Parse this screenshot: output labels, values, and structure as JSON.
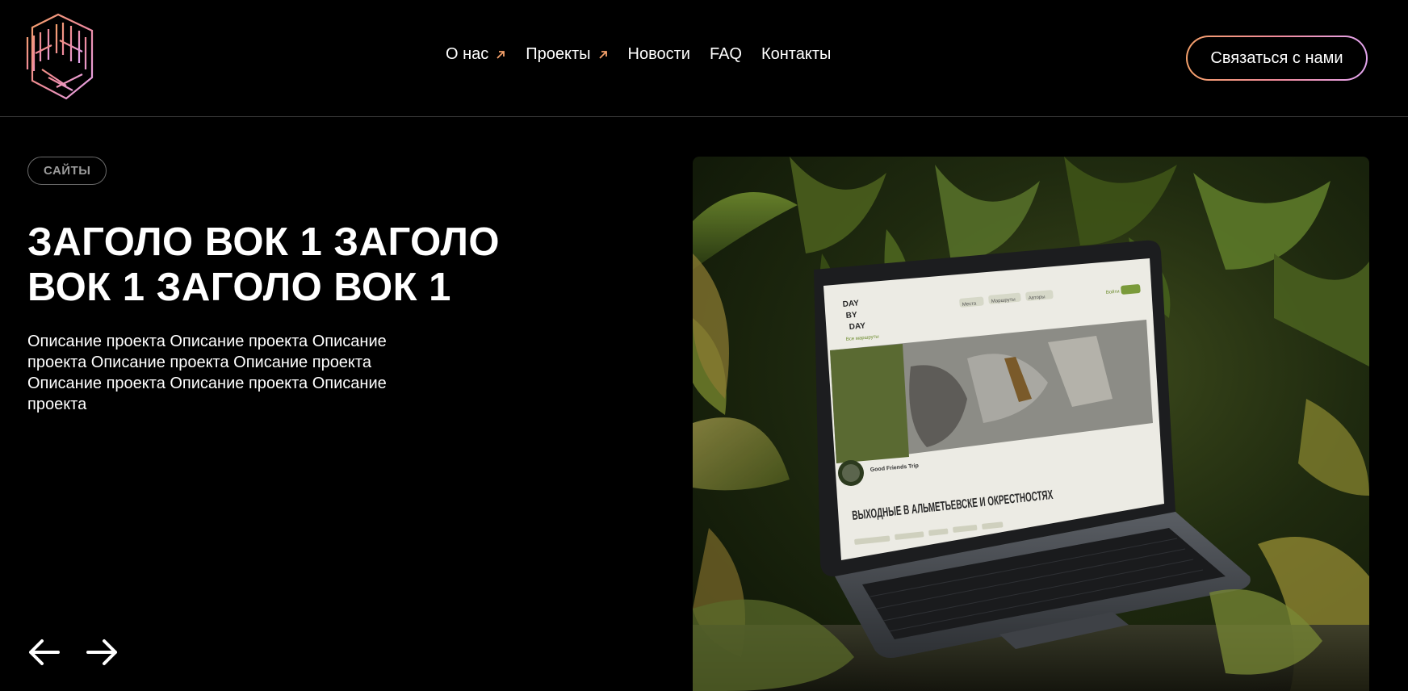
{
  "header": {
    "logo_icon": "500700-hex-logo",
    "nav": [
      {
        "label": "О нас",
        "external": true
      },
      {
        "label": "Проекты",
        "external": true
      },
      {
        "label": "Новости",
        "external": false
      },
      {
        "label": "FAQ",
        "external": false
      },
      {
        "label": "Контакты",
        "external": false
      }
    ],
    "cta_label": "Связаться с нами"
  },
  "hero": {
    "tag": "САЙТЫ",
    "title": "ЗАГОЛО ВОК 1 ЗАГОЛО ВОК 1 ЗАГОЛО ВОК 1",
    "description": "Описание проекта Описание проекта Описание проекта Описание проекта Описание проекта Описание проекта Описание проекта Описание проекта"
  },
  "screen": {
    "brand_lines": [
      "DAY",
      "BY",
      "DAY"
    ],
    "tabs": [
      "Места",
      "Маршруты",
      "Авторы"
    ],
    "login": "Войти",
    "back_link": "Все маршруты",
    "author": "Good Friends Trip",
    "headline": "ВЫХОДНЫЕ В АЛЬМЕТЬЕВСКЕ И ОКРЕСТНОСТЯХ"
  },
  "colors": {
    "accent_start": "#f4a06a",
    "accent_mid": "#f08a9a",
    "accent_end": "#e4a6f0",
    "background": "#000000"
  }
}
